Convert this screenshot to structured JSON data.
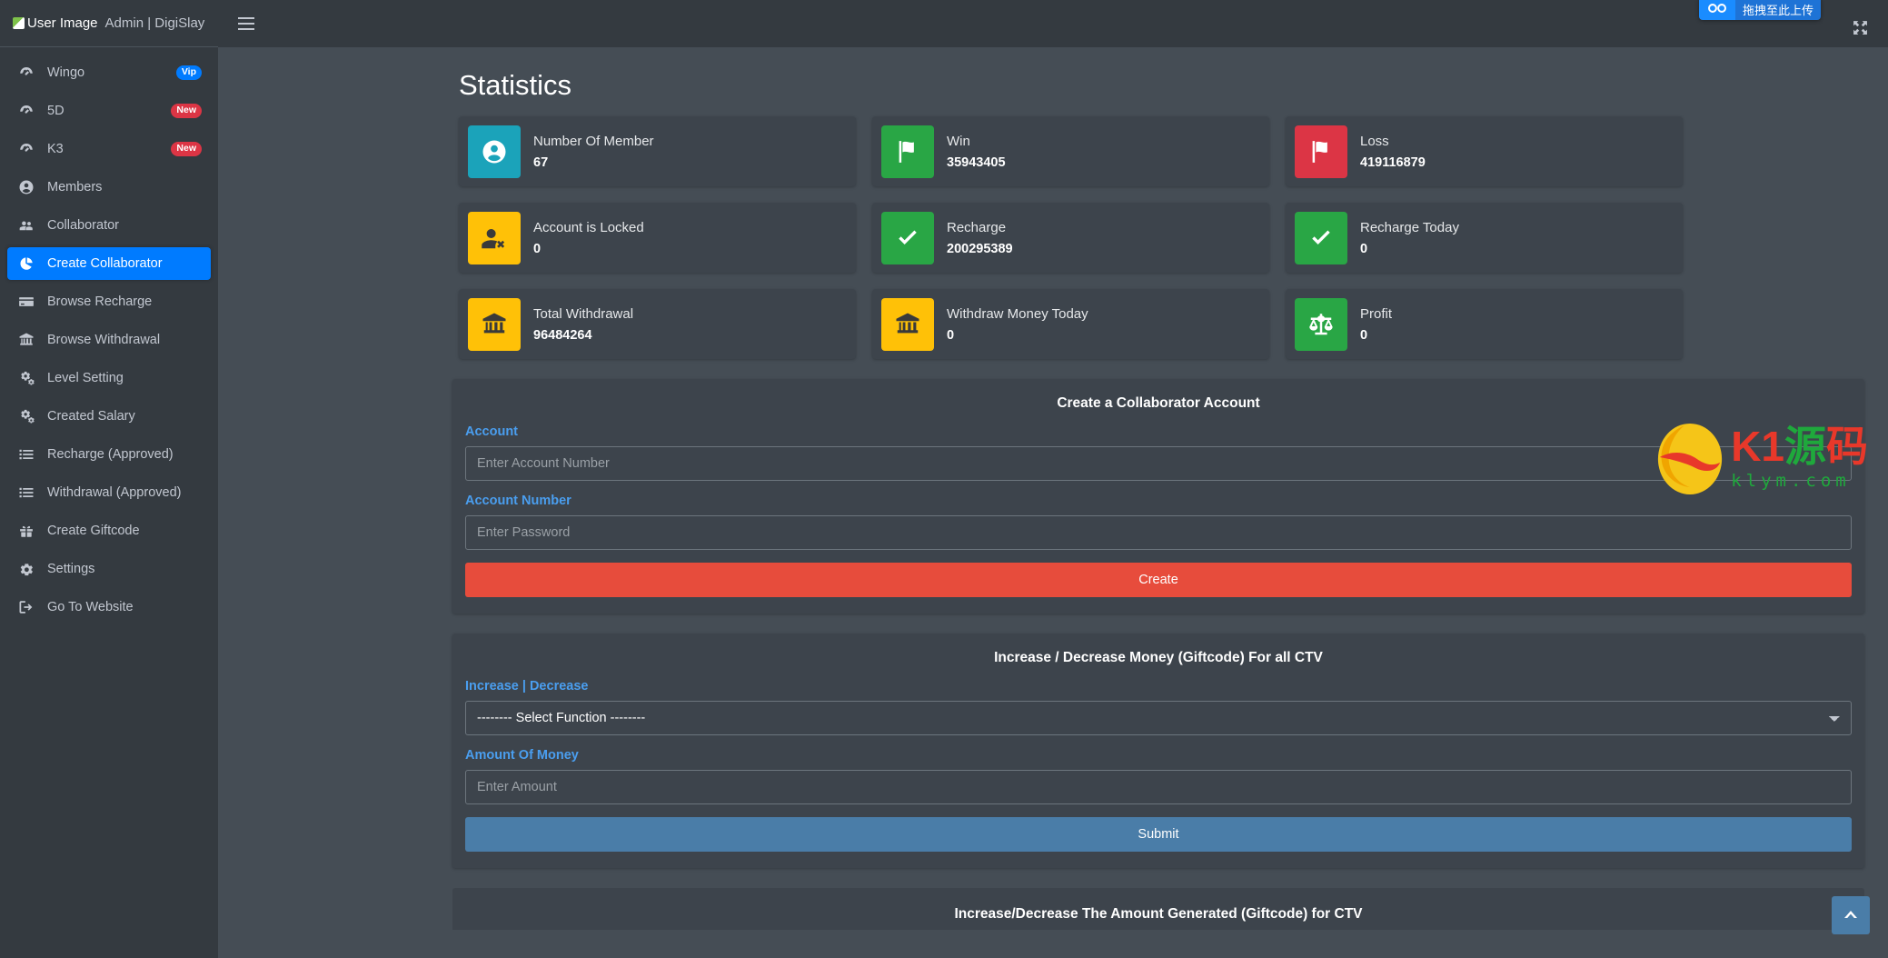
{
  "brand": {
    "image_alt": "User Image",
    "title": "Admin | DigiSlay"
  },
  "topbar": {
    "menu_icon": "hamburger-icon",
    "expand_icon": "expand-arrows-icon"
  },
  "extension_badge": {
    "icon": "infinity-icon",
    "label": "拖拽至此上传"
  },
  "watermark": {
    "main_a": "K1",
    "main_b": "源",
    "main_c": "码",
    "sub": "klym.com"
  },
  "sidebar": {
    "items": [
      {
        "label": "Wingo",
        "icon": "tachometer-icon",
        "badge": "Vip",
        "badge_type": "vip",
        "active": false
      },
      {
        "label": "5D",
        "icon": "tachometer-icon",
        "badge": "New",
        "badge_type": "new",
        "active": false
      },
      {
        "label": "K3",
        "icon": "tachometer-icon",
        "badge": "New",
        "badge_type": "new",
        "active": false
      },
      {
        "label": "Members",
        "icon": "user-circle-icon",
        "badge": "",
        "badge_type": "",
        "active": false
      },
      {
        "label": "Collaborator",
        "icon": "users-icon",
        "badge": "",
        "badge_type": "",
        "active": false
      },
      {
        "label": "Create Collaborator",
        "icon": "pie-chart-icon",
        "badge": "",
        "badge_type": "",
        "active": true
      },
      {
        "label": "Browse Recharge",
        "icon": "credit-card-icon",
        "badge": "",
        "badge_type": "",
        "active": false
      },
      {
        "label": "Browse Withdrawal",
        "icon": "bank-icon",
        "badge": "",
        "badge_type": "",
        "active": false
      },
      {
        "label": "Level Setting",
        "icon": "cogs-icon",
        "badge": "",
        "badge_type": "",
        "active": false
      },
      {
        "label": "Created Salary",
        "icon": "cogs-icon",
        "badge": "",
        "badge_type": "",
        "active": false
      },
      {
        "label": "Recharge (Approved)",
        "icon": "list-icon",
        "badge": "",
        "badge_type": "",
        "active": false
      },
      {
        "label": "Withdrawal (Approved)",
        "icon": "list-icon",
        "badge": "",
        "badge_type": "",
        "active": false
      },
      {
        "label": "Create Giftcode",
        "icon": "gift-icon",
        "badge": "",
        "badge_type": "",
        "active": false
      },
      {
        "label": "Settings",
        "icon": "gear-icon",
        "badge": "",
        "badge_type": "",
        "active": false
      },
      {
        "label": "Go To Website",
        "icon": "sign-out-icon",
        "badge": "",
        "badge_type": "",
        "active": false
      }
    ]
  },
  "main": {
    "page_title": "Statistics",
    "stat_cards": [
      {
        "title": "Number Of Member",
        "value": "67",
        "icon": "user-circle-icon",
        "color": "#1ba3ba"
      },
      {
        "title": "Win",
        "value": "35943405",
        "icon": "flag-icon",
        "color": "#29a645"
      },
      {
        "title": "Loss",
        "value": "419116879",
        "icon": "flag-icon",
        "color": "#dc3545"
      },
      {
        "title": "Account is Locked",
        "value": "0",
        "icon": "user-times-icon",
        "color": "#ffc107"
      },
      {
        "title": "Recharge",
        "value": "200295389",
        "icon": "check-icon",
        "color": "#29a645"
      },
      {
        "title": "Recharge Today",
        "value": "0",
        "icon": "check-icon",
        "color": "#29a645"
      },
      {
        "title": "Total Withdrawal",
        "value": "96484264",
        "icon": "bank-icon",
        "color": "#ffc107"
      },
      {
        "title": "Withdraw Money Today",
        "value": "0",
        "icon": "bank-icon",
        "color": "#ffc107"
      },
      {
        "title": "Profit",
        "value": "0",
        "icon": "balance-icon",
        "color": "#29a645"
      }
    ],
    "panel_create": {
      "heading": "Create a Collaborator Account",
      "account_label": "Account",
      "account_placeholder": "Enter Account Number",
      "account_value": "",
      "password_label": "Account Number",
      "password_placeholder": "Enter Password",
      "password_value": "",
      "submit_label": "Create"
    },
    "panel_giftcode": {
      "heading": "Increase / Decrease Money (Giftcode) For all CTV",
      "select_label": "Increase | Decrease",
      "select_value": "-------- Select Function --------",
      "select_options": [
        "-------- Select Function --------"
      ],
      "amount_label": "Amount Of Money",
      "amount_placeholder": "Enter Amount",
      "amount_value": "",
      "submit_label": "Submit"
    },
    "panel_generated": {
      "heading": "Increase/Decrease The Amount Generated (Giftcode) for CTV"
    },
    "scroll_top_icon": "chevron-up-icon"
  }
}
